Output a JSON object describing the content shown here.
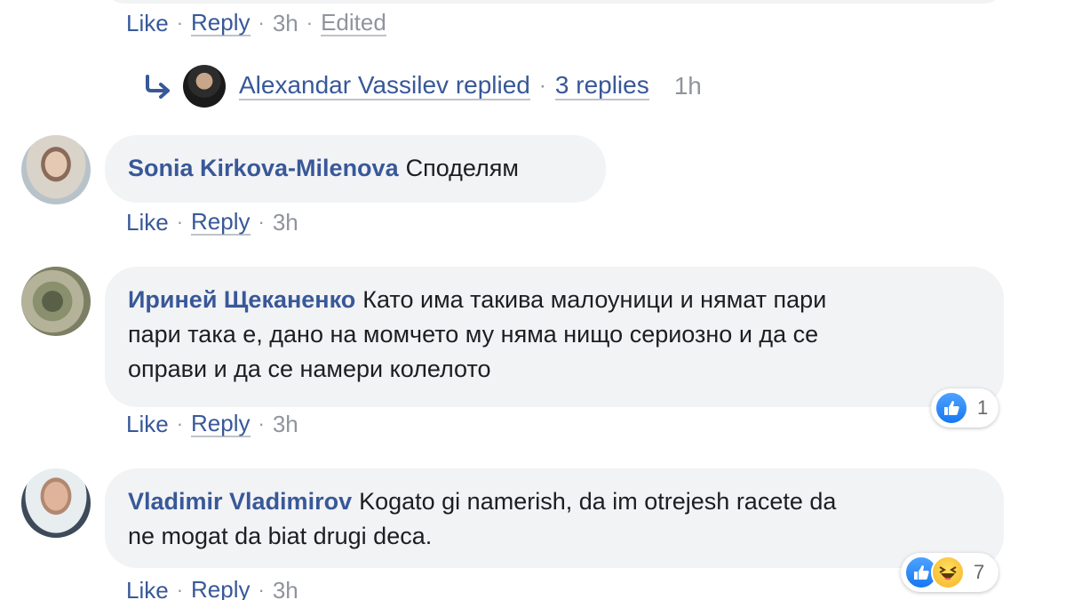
{
  "top_comment": {
    "actions": {
      "like": "Like",
      "reply": "Reply",
      "time": "3h",
      "edited": "Edited"
    },
    "reply_summary": {
      "replier": "Alexandar Vassilev replied",
      "count": "3 replies",
      "time": "1h"
    }
  },
  "comments": [
    {
      "author": "Sonia Kirkova-Milenova",
      "text": "Споделям",
      "actions": {
        "like": "Like",
        "reply": "Reply",
        "time": "3h"
      }
    },
    {
      "author": "Ириней Щеканенко",
      "text_lines": [
        "Като има такива малоуници и нямат пари",
        "пари така е, дано на момчето му няма нищо сериозно и да се",
        "оправи и да се намери колелото"
      ],
      "actions": {
        "like": "Like",
        "reply": "Reply",
        "time": "3h"
      },
      "reactions": {
        "types": [
          "like-icon"
        ],
        "count": "1"
      }
    },
    {
      "author": "Vladimir Vladimirov",
      "text_lines": [
        "Kogato gi namerish, da im otrejesh racete da",
        "ne mogat da biat drugi deca."
      ],
      "actions": {
        "like": "Like",
        "reply": "Reply",
        "time": "3h"
      },
      "reactions": {
        "types": [
          "like-icon",
          "haha-icon"
        ],
        "count": "7"
      }
    }
  ],
  "colors": {
    "link": "#385898",
    "meta": "#90949c",
    "bubble": "#f2f3f5",
    "like_blue": "#1877f2"
  },
  "separator": "·"
}
